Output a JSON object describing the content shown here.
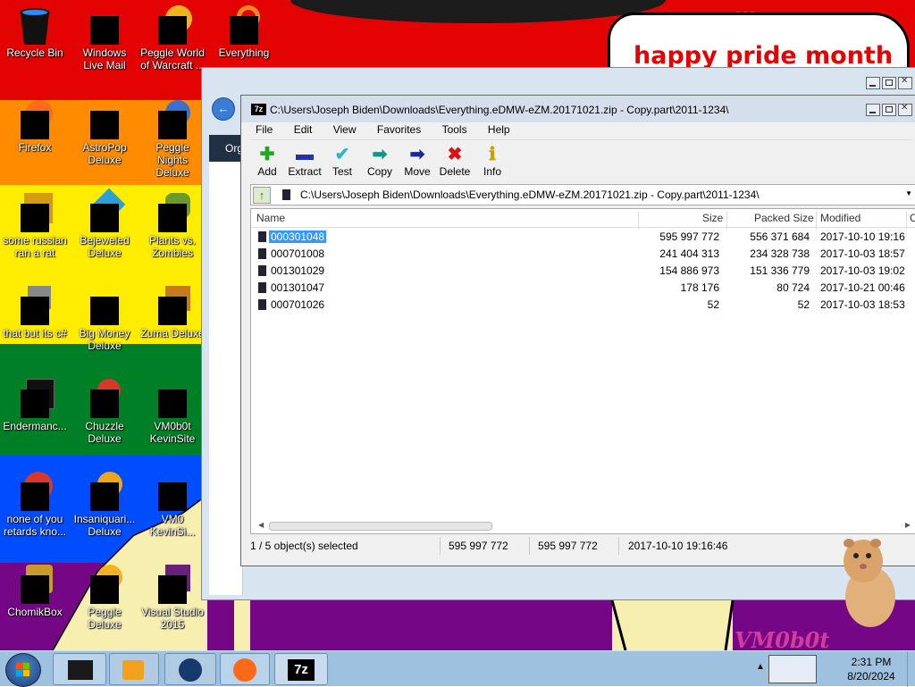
{
  "desktop": {
    "banner_text": "happy pride month",
    "corner_text": "VM0b0t",
    "icons": [
      {
        "label": "Recycle Bin"
      },
      {
        "label": "Windows Live Mail"
      },
      {
        "label": "Peggle World of Warcraft ..."
      },
      {
        "label": "Everything"
      },
      {
        "label": "Firefox"
      },
      {
        "label": "AstroPop Deluxe"
      },
      {
        "label": "Peggle Nights Deluxe"
      },
      {
        "label": "some russian ran a rat"
      },
      {
        "label": "Bejeweled Deluxe"
      },
      {
        "label": "Plants vs. Zombies"
      },
      {
        "label": "that but its c#"
      },
      {
        "label": "Big Money Deluxe"
      },
      {
        "label": "Zuma Deluxe"
      },
      {
        "label": "Endermanc..."
      },
      {
        "label": "Chuzzle Deluxe"
      },
      {
        "label": "VM0b0t KevinSite"
      },
      {
        "label": "none of you retards kno..."
      },
      {
        "label": "Insaniquari... Deluxe"
      },
      {
        "label": "VM0 KevinSi..."
      },
      {
        "label": "ChomikBox"
      },
      {
        "label": "Peggle Deluxe"
      },
      {
        "label": "Visual Studio 2015"
      }
    ]
  },
  "explorer": {
    "organize_label": "Org"
  },
  "zip": {
    "logo": "7z",
    "title": "C:\\Users\\Joseph Biden\\Downloads\\Everything.eDMW-eZM.20171021.zip - Copy.part\\2011-1234\\",
    "menu": [
      "File",
      "Edit",
      "View",
      "Favorites",
      "Tools",
      "Help"
    ],
    "toolbar": [
      {
        "label": "Add",
        "icon": "plus-icon",
        "glyph": "✚",
        "color": "#1faa1f"
      },
      {
        "label": "Extract",
        "icon": "minus-icon",
        "glyph": "▬",
        "color": "#2233aa"
      },
      {
        "label": "Test",
        "icon": "check-icon",
        "glyph": "✔",
        "color": "#2bb5c8"
      },
      {
        "label": "Copy",
        "icon": "copy-arrow-icon",
        "glyph": "➡",
        "color": "#15958a"
      },
      {
        "label": "Move",
        "icon": "move-arrow-icon",
        "glyph": "➡",
        "color": "#1a2a9a"
      },
      {
        "label": "Delete",
        "icon": "delete-icon",
        "glyph": "✖",
        "color": "#dd1111"
      },
      {
        "label": "Info",
        "icon": "info-icon",
        "glyph": "ℹ",
        "color": "#c8a000"
      }
    ],
    "path": "C:\\Users\\Joseph Biden\\Downloads\\Everything.eDMW-eZM.20171021.zip - Copy.part\\2011-1234\\",
    "columns": {
      "name": "Name",
      "size": "Size",
      "packed": "Packed Size",
      "modified": "Modified",
      "extra": "C"
    },
    "files": [
      {
        "name": "000301048",
        "size": "595 997 772",
        "packed": "556 371 684",
        "modified": "2017-10-10 19:16",
        "selected": true
      },
      {
        "name": "000701008",
        "size": "241 404 313",
        "packed": "234 328 738",
        "modified": "2017-10-03 18:57",
        "selected": false
      },
      {
        "name": "001301029",
        "size": "154 886 973",
        "packed": "151 336 779",
        "modified": "2017-10-03 19:02",
        "selected": false
      },
      {
        "name": "001301047",
        "size": "178 176",
        "packed": "80 724",
        "modified": "2017-10-21 00:46",
        "selected": false
      },
      {
        "name": "000701026",
        "size": "52",
        "packed": "52",
        "modified": "2017-10-03 18:53",
        "selected": false
      }
    ],
    "status": {
      "selection": "1 / 5 object(s) selected",
      "size": "595 997 772",
      "packed": "595 997 772",
      "modified": "2017-10-10 19:16:46"
    }
  },
  "taskbar": {
    "time": "2:31 PM",
    "date": "8/20/2024"
  }
}
